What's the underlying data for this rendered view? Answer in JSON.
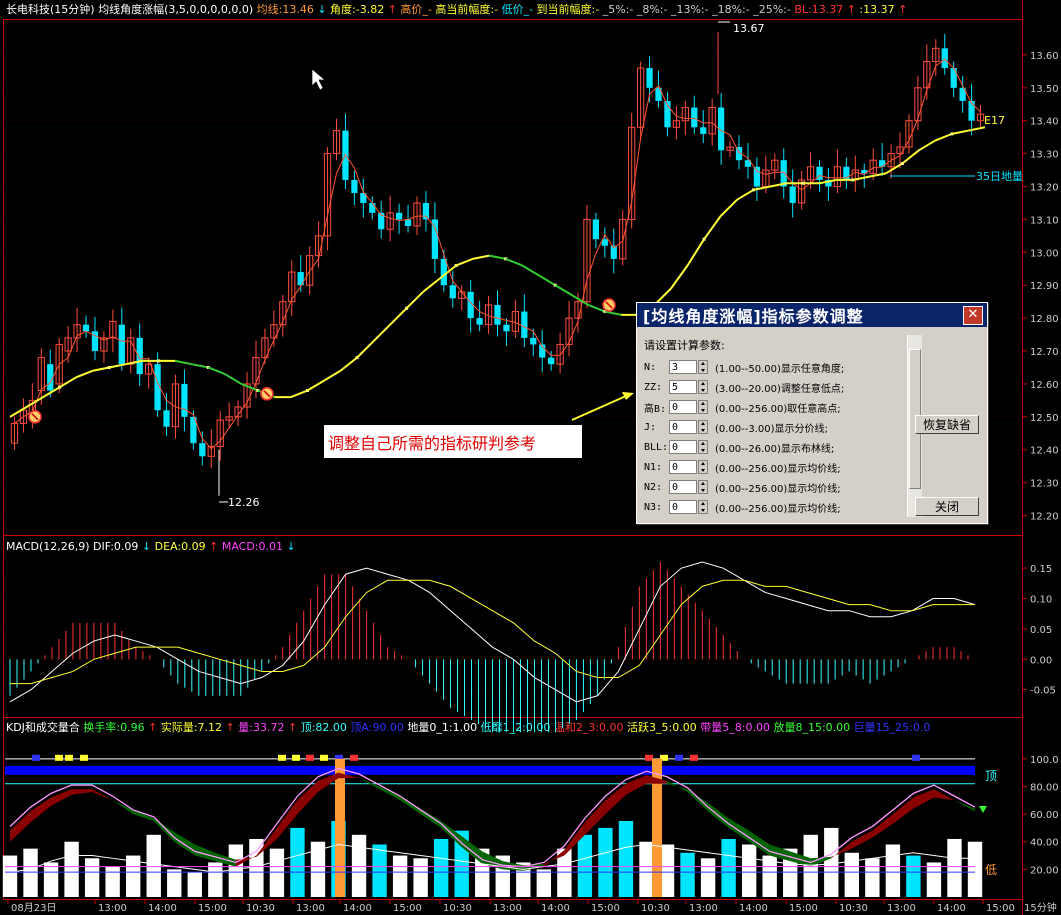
{
  "colors": {
    "bg": "#000000",
    "axis": "#cc0000",
    "up": "#ff4d3d",
    "down": "#00e5ff",
    "ma_fast": "#ff5533",
    "ma_trend_up": "#ffff33",
    "ma_trend_down": "#33cc33",
    "dif": "#ffffff",
    "dea": "#ffff33",
    "macd_pos": "#ff3333",
    "macd_neg": "#33ffff",
    "kdj_k": "#ff99ff",
    "kdj_j": "#ffffff",
    "blue_bar": "#0000ff",
    "orange_bar": "#ff9933"
  },
  "main_panel": {
    "title_parts": [
      {
        "text": "长电科技(15分钟) 均线角度涨幅(3,5,0,0,0,0,0,0)",
        "color": "#ffffff"
      },
      {
        "text": "均线:13.46",
        "color": "#ff9933"
      },
      {
        "text": "↓",
        "color": "#00e5ff"
      },
      {
        "text": "角度:-3.82",
        "color": "#ffff33"
      },
      {
        "text": "↑",
        "color": "#ff3333"
      },
      {
        "text": "高价_-",
        "color": "#ff9933"
      },
      {
        "text": "高当前幅度:-",
        "color": "#ffff33"
      },
      {
        "text": "低价_-",
        "color": "#00e5ff"
      },
      {
        "text": "到当前幅度:-",
        "color": "#ffff33"
      },
      {
        "text": "_5%:- _8%:- _13%:- _18%:- _25%:-",
        "color": "#cccccc"
      },
      {
        "text": "BL:13.37",
        "color": "#ff3333"
      },
      {
        "text": "↑",
        "color": "#ff3333"
      },
      {
        "text": ":13.37",
        "color": "#ffff33"
      },
      {
        "text": "↑",
        "color": "#ff3333"
      }
    ],
    "y_ticks": [
      "13.60",
      "13.50",
      "13.40",
      "13.30",
      "13.20",
      "13.10",
      "13.00",
      "12.90",
      "12.80",
      "12.70",
      "12.60",
      "12.50",
      "12.40",
      "12.30",
      "12.20"
    ],
    "annotations": {
      "high": "13.67",
      "low": "12.26",
      "e17": "E17",
      "ma35": "35日地量"
    },
    "note": "调整自己所需的指标研判参考"
  },
  "macd_panel": {
    "title_parts": [
      {
        "text": "MACD(12,26,9)",
        "color": "#ffffff"
      },
      {
        "text": "DIF:0.09",
        "color": "#ffffff"
      },
      {
        "text": "↓",
        "color": "#00e5ff"
      },
      {
        "text": "DEA:0.09",
        "color": "#ffff33"
      },
      {
        "text": "↑",
        "color": "#ff3333"
      },
      {
        "text": "MACD:0.01",
        "color": "#ff44ff"
      },
      {
        "text": "↓",
        "color": "#00e5ff"
      }
    ],
    "y_ticks": [
      "0.15",
      "0.10",
      "0.05",
      "0.00",
      "-0.05"
    ]
  },
  "kdj_panel": {
    "title_parts": [
      {
        "text": "KDJ和成交量合",
        "color": "#ffffff"
      },
      {
        "text": "换手率:0.96",
        "color": "#33ff33"
      },
      {
        "text": "↑",
        "color": "#ff3333"
      },
      {
        "text": "实际量:7.12",
        "color": "#ffff33"
      },
      {
        "text": "↑",
        "color": "#ff3333"
      },
      {
        "text": "量:33.72",
        "color": "#ff44ff"
      },
      {
        "text": "↑",
        "color": "#ff3333"
      },
      {
        "text": "顶:82.00",
        "color": "#33ffff"
      },
      {
        "text": "顶A:90.00",
        "color": "#3333ff"
      },
      {
        "text": "地量0_1:1.00",
        "color": "#ffffff"
      },
      {
        "text": "低靡1_2:0.00",
        "color": "#33ffff"
      },
      {
        "text": "温和2_3:0.00",
        "color": "#ff3333"
      },
      {
        "text": "活跃3_5:0.00",
        "color": "#ffff33"
      },
      {
        "text": "带量5_8:0.00",
        "color": "#ff44ff"
      },
      {
        "text": "放量8_15:0.00",
        "color": "#33ff33"
      },
      {
        "text": "巨量15_25:0.0",
        "color": "#3333ff"
      }
    ],
    "y_ticks": [
      "100.0",
      "80.00",
      "60.00",
      "40.00",
      "20.00"
    ],
    "top_label": "顶",
    "bottom_label": "低"
  },
  "x_axis": {
    "labels": [
      "08月23日",
      "13:00",
      "14:00",
      "15:00",
      "10:30",
      "13:00",
      "14:00",
      "15:00",
      "10:30",
      "13:00",
      "14:00",
      "15:00",
      "10:30",
      "13:00",
      "14:00",
      "15:00",
      "10:30",
      "13:00",
      "14:00",
      "15:00"
    ],
    "period": "15分钟"
  },
  "dialog": {
    "title": "[均线角度涨幅]指标参数调整",
    "prompt": "请设置计算参数:",
    "rows": [
      {
        "label": "N:",
        "value": "3",
        "desc": "(1.00--50.00)显示任意角度;"
      },
      {
        "label": "ZZ:",
        "value": "5",
        "desc": "(3.00--20.00)调整任意低点;"
      },
      {
        "label": "高B:",
        "value": "0",
        "desc": "(0.00--256.00)取任意高点;"
      },
      {
        "label": "J:",
        "value": "0",
        "desc": "(0.00--3.00)显示分价线;"
      },
      {
        "label": "BLL:",
        "value": "0",
        "desc": "(0.00--26.00)显示布林线;"
      },
      {
        "label": "N1:",
        "value": "0",
        "desc": "(0.00--256.00)显示均价线;"
      },
      {
        "label": "N2:",
        "value": "0",
        "desc": "(0.00--256.00)显示均价线;"
      },
      {
        "label": "N3:",
        "value": "0",
        "desc": "(0.00--256.00)显示均价线;"
      }
    ],
    "btn_restore": "恢复缺省",
    "btn_close": "关闭"
  },
  "chart_data": [
    {
      "type": "candlestick",
      "ylim": [
        12.15,
        13.7
      ],
      "close": [
        12.48,
        12.52,
        12.55,
        12.68,
        12.58,
        12.72,
        12.74,
        12.78,
        12.76,
        12.7,
        12.74,
        12.79,
        12.66,
        12.74,
        12.63,
        12.66,
        12.52,
        12.47,
        12.6,
        12.5,
        12.42,
        12.38,
        12.41,
        12.49,
        12.5,
        12.53,
        12.6,
        12.68,
        12.74,
        12.78,
        12.85,
        12.94,
        12.9,
        12.99,
        13.05,
        13.3,
        13.37,
        13.22,
        13.18,
        13.15,
        13.12,
        13.07,
        13.12,
        13.1,
        13.08,
        13.15,
        13.1,
        12.98,
        12.9,
        12.86,
        12.88,
        12.8,
        12.78,
        12.84,
        12.78,
        12.76,
        12.82,
        12.74,
        12.72,
        12.68,
        12.66,
        12.72,
        12.8,
        12.85,
        13.1,
        13.04,
        13.02,
        12.98,
        13.1,
        13.38,
        13.56,
        13.5,
        13.46,
        13.38,
        13.4,
        13.44,
        13.38,
        13.36,
        13.44,
        13.31,
        13.32,
        13.28,
        13.26,
        13.2,
        13.25,
        13.28,
        13.2,
        13.15,
        13.22,
        13.26,
        13.22,
        13.2,
        13.26,
        13.22,
        13.25,
        13.24,
        13.28,
        13.26,
        13.3,
        13.32,
        13.4,
        13.5,
        13.58,
        13.62,
        13.56,
        13.5,
        13.46,
        13.4,
        13.42
      ],
      "open": [
        12.42,
        12.48,
        12.5,
        12.58,
        12.66,
        12.6,
        12.7,
        12.74,
        12.78,
        12.76,
        12.7,
        12.74,
        12.78,
        12.66,
        12.74,
        12.63,
        12.66,
        12.52,
        12.47,
        12.6,
        12.5,
        12.42,
        12.38,
        12.41,
        12.49,
        12.5,
        12.53,
        12.6,
        12.68,
        12.74,
        12.78,
        12.85,
        12.94,
        12.9,
        12.99,
        13.05,
        13.3,
        13.37,
        13.22,
        13.18,
        13.15,
        13.12,
        13.07,
        13.12,
        13.1,
        13.08,
        13.15,
        13.1,
        12.98,
        12.9,
        12.86,
        12.88,
        12.8,
        12.78,
        12.84,
        12.78,
        12.76,
        12.82,
        12.74,
        12.72,
        12.68,
        12.66,
        12.72,
        12.8,
        12.85,
        13.1,
        13.04,
        13.02,
        12.98,
        13.1,
        13.38,
        13.56,
        13.5,
        13.46,
        13.38,
        13.4,
        13.44,
        13.38,
        13.36,
        13.44,
        13.31,
        13.32,
        13.28,
        13.26,
        13.2,
        13.25,
        13.28,
        13.2,
        13.15,
        13.22,
        13.26,
        13.22,
        13.2,
        13.26,
        13.22,
        13.25,
        13.24,
        13.28,
        13.26,
        13.3,
        13.32,
        13.4,
        13.5,
        13.58,
        13.62,
        13.56,
        13.5,
        13.46,
        13.4
      ],
      "high_label": 13.67,
      "low_label": 12.26,
      "ma_trend": [
        12.5,
        12.53,
        12.56,
        12.59,
        12.62,
        12.64,
        12.65,
        12.66,
        12.67,
        12.67,
        12.67,
        12.66,
        12.65,
        12.63,
        12.6,
        12.58,
        12.56,
        12.56,
        12.58,
        12.61,
        12.64,
        12.68,
        12.73,
        12.78,
        12.83,
        12.88,
        12.92,
        12.96,
        12.98,
        12.99,
        12.98,
        12.96,
        12.93,
        12.9,
        12.87,
        12.84,
        12.82,
        12.81,
        12.81,
        12.84,
        12.89,
        12.96,
        13.04,
        13.11,
        13.16,
        13.19,
        13.2,
        13.21,
        13.21,
        13.21,
        13.22,
        13.22,
        13.23,
        13.24,
        13.27,
        13.31,
        13.34,
        13.36,
        13.37,
        13.38
      ]
    },
    {
      "type": "macd",
      "ylim": [
        -0.09,
        0.17
      ],
      "dif": [
        -0.07,
        -0.05,
        -0.02,
        0.01,
        0.03,
        0.04,
        0.03,
        0.02,
        0.0,
        -0.02,
        -0.03,
        -0.04,
        -0.03,
        -0.01,
        0.03,
        0.09,
        0.14,
        0.15,
        0.14,
        0.13,
        0.11,
        0.08,
        0.05,
        0.02,
        0.0,
        -0.03,
        -0.05,
        -0.07,
        -0.06,
        -0.02,
        0.05,
        0.12,
        0.15,
        0.16,
        0.15,
        0.13,
        0.11,
        0.1,
        0.09,
        0.08,
        0.08,
        0.07,
        0.07,
        0.08,
        0.1,
        0.1,
        0.09
      ],
      "dea": [
        -0.04,
        -0.04,
        -0.03,
        -0.02,
        0.0,
        0.01,
        0.02,
        0.02,
        0.02,
        0.01,
        0.0,
        -0.01,
        -0.02,
        -0.02,
        -0.01,
        0.02,
        0.07,
        0.11,
        0.13,
        0.13,
        0.13,
        0.12,
        0.1,
        0.08,
        0.06,
        0.03,
        0.01,
        -0.02,
        -0.03,
        -0.03,
        -0.01,
        0.04,
        0.09,
        0.12,
        0.13,
        0.13,
        0.12,
        0.12,
        0.11,
        0.1,
        0.09,
        0.09,
        0.08,
        0.08,
        0.09,
        0.09,
        0.09
      ]
    },
    {
      "type": "kdj_volume",
      "ylim": [
        0,
        110
      ],
      "k": [
        48,
        62,
        72,
        78,
        78,
        70,
        60,
        55,
        40,
        30,
        26,
        22,
        30,
        50,
        70,
        84,
        90,
        86,
        78,
        70,
        60,
        50,
        36,
        24,
        20,
        19,
        22,
        34,
        54,
        70,
        82,
        88,
        84,
        76,
        62,
        50,
        40,
        30,
        26,
        22,
        28,
        40,
        48,
        60,
        72,
        78,
        70,
        62
      ],
      "d": [
        40,
        54,
        66,
        74,
        76,
        70,
        63,
        57,
        47,
        38,
        32,
        27,
        29,
        42,
        60,
        76,
        86,
        86,
        80,
        73,
        64,
        55,
        44,
        33,
        26,
        23,
        24,
        30,
        45,
        60,
        74,
        82,
        82,
        78,
        68,
        57,
        48,
        38,
        33,
        28,
        29,
        35,
        43,
        53,
        64,
        72,
        70,
        64
      ],
      "j": [
        10,
        12,
        18,
        22,
        22,
        20,
        18,
        16,
        14,
        12,
        10,
        12,
        14,
        18,
        22,
        26,
        30,
        28,
        26,
        24,
        22,
        20,
        18,
        16,
        14,
        12,
        14,
        16,
        20,
        24,
        28,
        30,
        28,
        26,
        24,
        22,
        20,
        18,
        16,
        15,
        16,
        18,
        20,
        22,
        24,
        22,
        20,
        20
      ],
      "volume": [
        30,
        35,
        25,
        40,
        28,
        22,
        30,
        45,
        20,
        18,
        25,
        38,
        42,
        35,
        50,
        40,
        55,
        45,
        38,
        30,
        28,
        42,
        48,
        35,
        30,
        25,
        20,
        35,
        45,
        50,
        55,
        40,
        38,
        32,
        28,
        42,
        38,
        30,
        35,
        45,
        50,
        32,
        28,
        38,
        30,
        25,
        42,
        40
      ],
      "highlight_volume": [
        false,
        false,
        false,
        false,
        false,
        false,
        false,
        false,
        false,
        false,
        false,
        false,
        false,
        false,
        true,
        false,
        true,
        false,
        true,
        false,
        false,
        true,
        true,
        false,
        false,
        false,
        false,
        false,
        true,
        true,
        true,
        false,
        false,
        true,
        false,
        true,
        false,
        false,
        false,
        false,
        false,
        false,
        false,
        false,
        true,
        false,
        false,
        false
      ]
    }
  ]
}
